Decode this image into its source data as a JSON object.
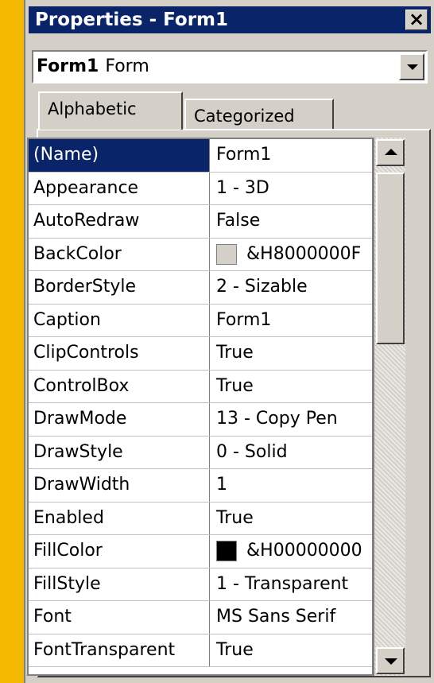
{
  "window": {
    "title": "Properties - Form1",
    "close_glyph": "×"
  },
  "object_selector": {
    "name": "Form1",
    "type": "Form"
  },
  "tabs": [
    {
      "label": "Alphabetic",
      "active": true
    },
    {
      "label": "Categorized",
      "active": false
    }
  ],
  "properties": [
    {
      "name": "(Name)",
      "value": "Form1"
    },
    {
      "name": "Appearance",
      "value": "1 - 3D"
    },
    {
      "name": "AutoRedraw",
      "value": "False"
    },
    {
      "name": "BackColor",
      "value": "&H8000000F",
      "swatch": "#d4d0c8"
    },
    {
      "name": "BorderStyle",
      "value": "2 - Sizable"
    },
    {
      "name": "Caption",
      "value": "Form1"
    },
    {
      "name": "ClipControls",
      "value": "True"
    },
    {
      "name": "ControlBox",
      "value": "True"
    },
    {
      "name": "DrawMode",
      "value": "13 - Copy Pen"
    },
    {
      "name": "DrawStyle",
      "value": "0 - Solid"
    },
    {
      "name": "DrawWidth",
      "value": "1"
    },
    {
      "name": "Enabled",
      "value": "True"
    },
    {
      "name": "FillColor",
      "value": "&H00000000",
      "swatch": "#000000"
    },
    {
      "name": "FillStyle",
      "value": "1 - Transparent"
    },
    {
      "name": "Font",
      "value": "MS Sans Serif"
    },
    {
      "name": "FontTransparent",
      "value": "True"
    }
  ],
  "colors": {
    "titlebar": "#0a246a",
    "selection": "#0a246a",
    "background": "#f5b800"
  }
}
